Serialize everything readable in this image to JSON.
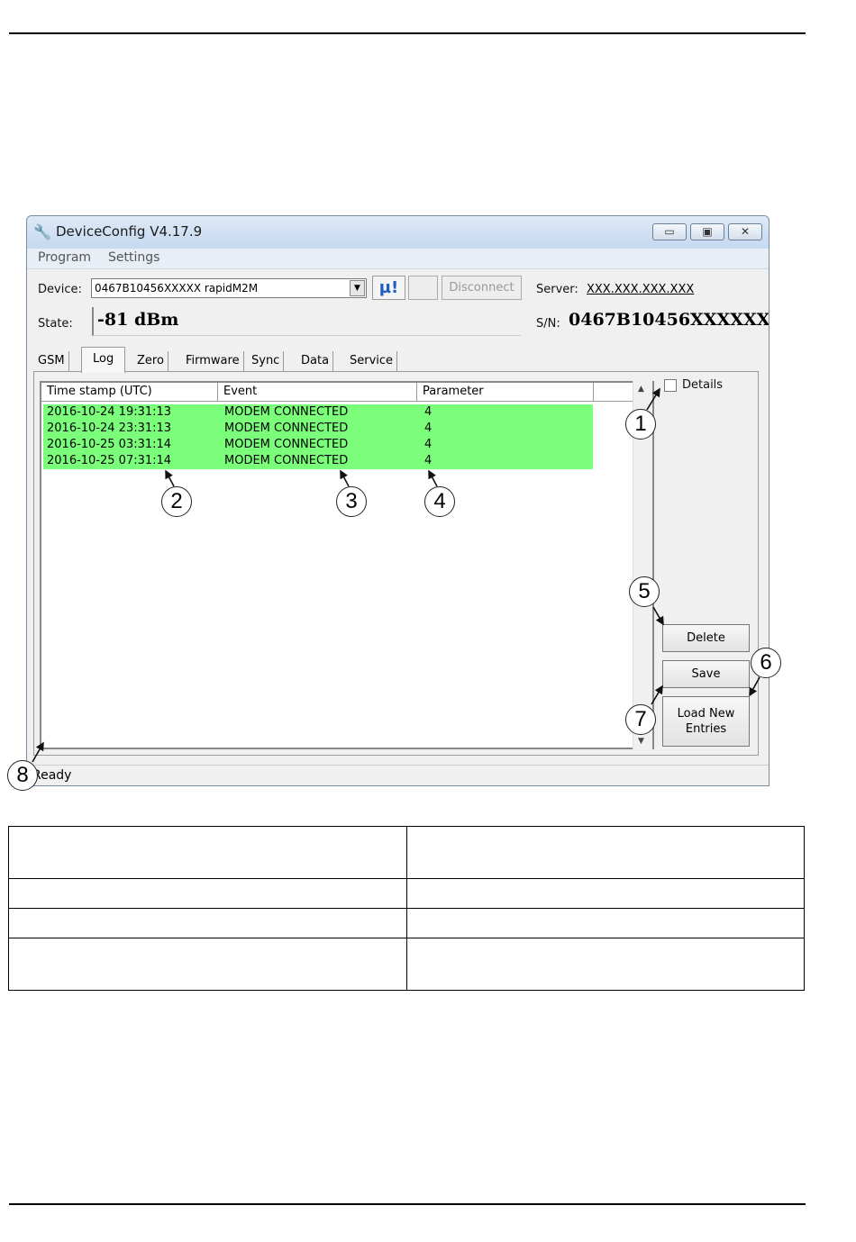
{
  "window": {
    "title": "DeviceConfig V4.17.9",
    "controls": {
      "minimize": "▭",
      "maximize": "▣",
      "close": "✕"
    }
  },
  "menu": [
    "Program",
    "Settings"
  ],
  "device": {
    "label": "Device:",
    "value": "0467B10456XXXXX rapidM2M",
    "bluetooth_label": "µ!",
    "disconnect_label": "Disconnect",
    "server_label": "Server:",
    "server_value": "XXX.XXX.XXX.XXX",
    "state_label": "State:",
    "state_value": "-81 dBm",
    "sn_label": "S/N:",
    "sn_value": "0467B10456XXXXXX"
  },
  "tabs": [
    "GSM",
    "Log",
    "Zero",
    "Firmware",
    "Sync",
    "Data",
    "Service"
  ],
  "active_tab": "Log",
  "log": {
    "columns": [
      "Time stamp (UTC)",
      "Event",
      "Parameter"
    ],
    "rows": [
      {
        "time": "2016-10-24 19:31:13",
        "event": "MODEM CONNECTED",
        "param": "4"
      },
      {
        "time": "2016-10-24 23:31:13",
        "event": "MODEM CONNECTED",
        "param": "4"
      },
      {
        "time": "2016-10-25 03:31:14",
        "event": "MODEM CONNECTED",
        "param": "4"
      },
      {
        "time": "2016-10-25 07:31:14",
        "event": "MODEM CONNECTED",
        "param": "4"
      }
    ],
    "row_color": "#7bff7b"
  },
  "side": {
    "details_label": "Details",
    "delete_label": "Delete",
    "save_label": "Save",
    "load_line1": "Load New",
    "load_line2": "Entries"
  },
  "status": "Ready",
  "callouts": [
    "1",
    "2",
    "3",
    "4",
    "5",
    "6",
    "7",
    "8"
  ]
}
